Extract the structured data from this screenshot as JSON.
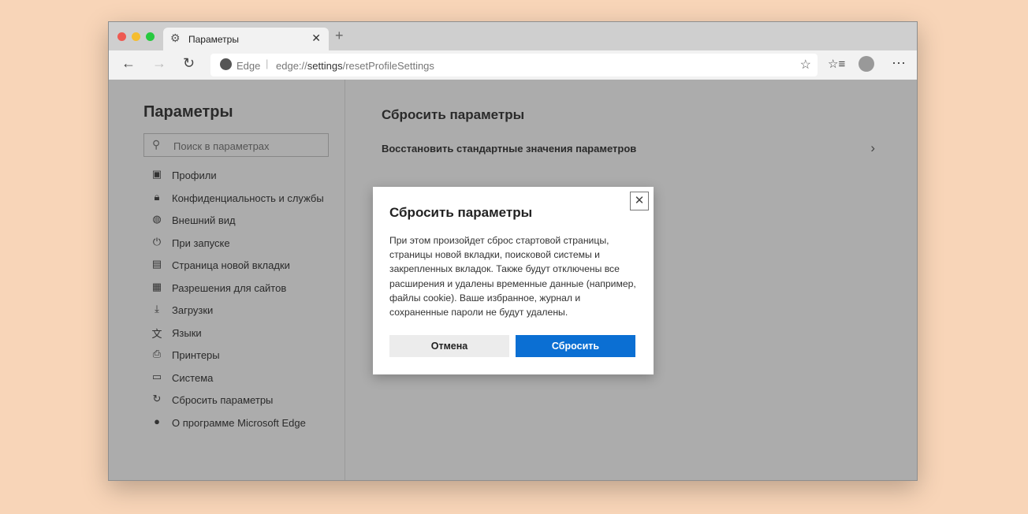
{
  "browser": {
    "tab_title": "Параметры",
    "address_brand": "Edge",
    "url_prefix": "edge://",
    "url_bold": "settings",
    "url_suffix": "/resetProfileSettings"
  },
  "sidebar": {
    "title": "Параметры",
    "search_placeholder": "Поиск в параметрах",
    "items": [
      {
        "label": "Профили",
        "icon": "profile-icon",
        "glyph": "▣"
      },
      {
        "label": "Конфиденциальность и службы",
        "icon": "lock-icon",
        "glyph": "🔒︎"
      },
      {
        "label": "Внешний вид",
        "icon": "palette-icon",
        "glyph": "◍"
      },
      {
        "label": "При запуске",
        "icon": "power-icon",
        "glyph": "⏻"
      },
      {
        "label": "Страница новой вкладки",
        "icon": "new-tab-icon",
        "glyph": "▤"
      },
      {
        "label": "Разрешения для сайтов",
        "icon": "site-permissions-icon",
        "glyph": "▦"
      },
      {
        "label": "Загрузки",
        "icon": "download-icon",
        "glyph": "⤓"
      },
      {
        "label": "Языки",
        "icon": "languages-icon",
        "glyph": "文"
      },
      {
        "label": "Принтеры",
        "icon": "printer-icon",
        "glyph": "⎙"
      },
      {
        "label": "Система",
        "icon": "laptop-icon",
        "glyph": "▭"
      },
      {
        "label": "Сбросить параметры",
        "icon": "reset-icon",
        "glyph": "↻"
      },
      {
        "label": "О программе Microsoft Edge",
        "icon": "edge-logo-icon",
        "glyph": "●"
      }
    ]
  },
  "main": {
    "title": "Сбросить параметры",
    "row_label": "Восстановить стандартные значения параметров"
  },
  "dialog": {
    "title": "Сбросить параметры",
    "body": "При этом произойдет сброс стартовой страницы, страницы новой вкладки, поисковой системы и закрепленных вкладок. Также будут отключены все расширения и удалены временные данные (например, файлы cookie). Ваше избранное, журнал и сохраненные пароли не будут удалены.",
    "cancel": "Отмена",
    "confirm": "Сбросить"
  },
  "colors": {
    "accent": "#0b6fd3",
    "background": "#f8d5b8",
    "overlay": "#acacac"
  }
}
